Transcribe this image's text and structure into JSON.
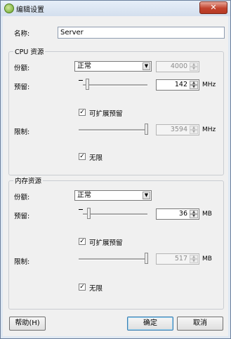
{
  "window": {
    "title": "编辑设置",
    "close_glyph": "✕"
  },
  "name": {
    "label": "名称:",
    "value": "Server"
  },
  "cpu": {
    "group_title": "CPU 资源",
    "shares_label": "份额:",
    "shares_value": "正常",
    "shares_number": "4000",
    "reservation_label": "预留:",
    "reservation_value": "142",
    "reservation_unit": "MHz",
    "expandable_label": "可扩展预留",
    "expandable_checked": true,
    "limit_label": "限制:",
    "limit_value": "3594",
    "limit_unit": "MHz",
    "unlimited_label": "无限",
    "unlimited_checked": true
  },
  "memory": {
    "group_title": "内存资源",
    "shares_label": "份额:",
    "shares_value": "正常",
    "reservation_label": "预留:",
    "reservation_value": "36",
    "reservation_unit": "MB",
    "expandable_label": "可扩展预留",
    "expandable_checked": true,
    "limit_label": "限制:",
    "limit_value": "517",
    "limit_unit": "MB",
    "unlimited_label": "无限",
    "unlimited_checked": true
  },
  "buttons": {
    "help": "帮助(H)",
    "ok": "确定",
    "cancel": "取消"
  },
  "icons": {
    "check_glyph": "✓",
    "dropdown_glyph": "▼",
    "spin_up_glyph": "▲",
    "spin_down_glyph": "▼"
  }
}
